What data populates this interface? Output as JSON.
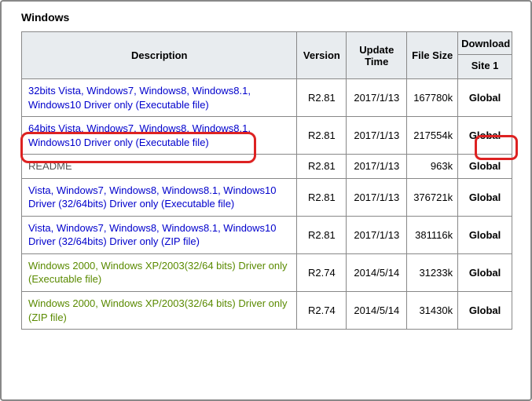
{
  "section_title": "Windows",
  "headers": {
    "description": "Description",
    "version": "Version",
    "update_time": "Update Time",
    "file_size": "File Size",
    "download": "Download",
    "site1": "Site 1"
  },
  "rows": [
    {
      "desc": "32bits Vista, Windows7, Windows8, Windows8.1, Windows10 Driver only (Executable file)",
      "version": "R2.81",
      "update": "2017/1/13",
      "size": "167780k",
      "download": "Global",
      "style": "blue"
    },
    {
      "desc": "64bits Vista, Windows7, Windows8, Windows8.1, Windows10 Driver only (Executable file)",
      "version": "R2.81",
      "update": "2017/1/13",
      "size": "217554k",
      "download": "Global",
      "style": "blue"
    },
    {
      "desc": "README",
      "version": "R2.81",
      "update": "2017/1/13",
      "size": "963k",
      "download": "Global",
      "style": "readme"
    },
    {
      "desc": "Vista, Windows7, Windows8, Windows8.1, Windows10 Driver (32/64bits) Driver only (Executable file)",
      "version": "R2.81",
      "update": "2017/1/13",
      "size": "376721k",
      "download": "Global",
      "style": "blue"
    },
    {
      "desc": "Vista, Windows7, Windows8, Windows8.1, Windows10 Driver (32/64bits) Driver only (ZIP file)",
      "version": "R2.81",
      "update": "2017/1/13",
      "size": "381116k",
      "download": "Global",
      "style": "blue"
    },
    {
      "desc": "Windows 2000, Windows XP/2003(32/64 bits) Driver only (Executable file)",
      "version": "R2.74",
      "update": "2014/5/14",
      "size": "31233k",
      "download": "Global",
      "style": "olive"
    },
    {
      "desc": "Windows 2000, Windows XP/2003(32/64 bits) Driver only (ZIP file)",
      "version": "R2.74",
      "update": "2014/5/14",
      "size": "31430k",
      "download": "Global",
      "style": "olive"
    }
  ]
}
